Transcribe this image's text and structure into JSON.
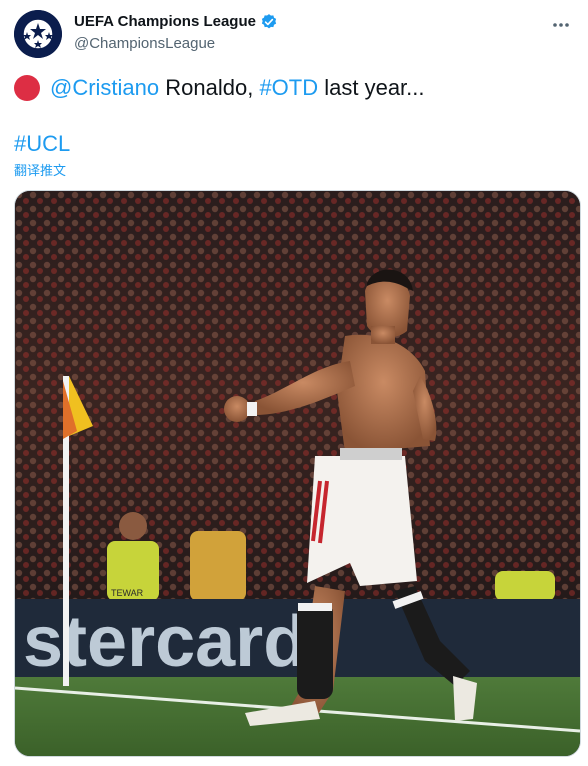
{
  "account": {
    "display_name": "UEFA Champions League",
    "handle": "@ChampionsLeague"
  },
  "tweet": {
    "mention": "@Cristiano",
    "text_after_mention": " Ronaldo, ",
    "hashtag_otd": "#OTD",
    "text_tail": " last year...",
    "hashtag_ucl": "#UCL",
    "translate_label": "翻译推文"
  },
  "icons": {
    "avatar": "champions-league-starball-logo",
    "verified": "verified-badge-icon",
    "more": "more-options-icon",
    "emoji": "red-circle-emoji"
  },
  "media": {
    "board_text": "stercard",
    "shirt_text": "TEWAR"
  },
  "colors": {
    "link": "#1d9bf0",
    "handle": "#536471",
    "avatar_bg": "#0b1d4d",
    "red_emoji": "#dd2e44"
  }
}
